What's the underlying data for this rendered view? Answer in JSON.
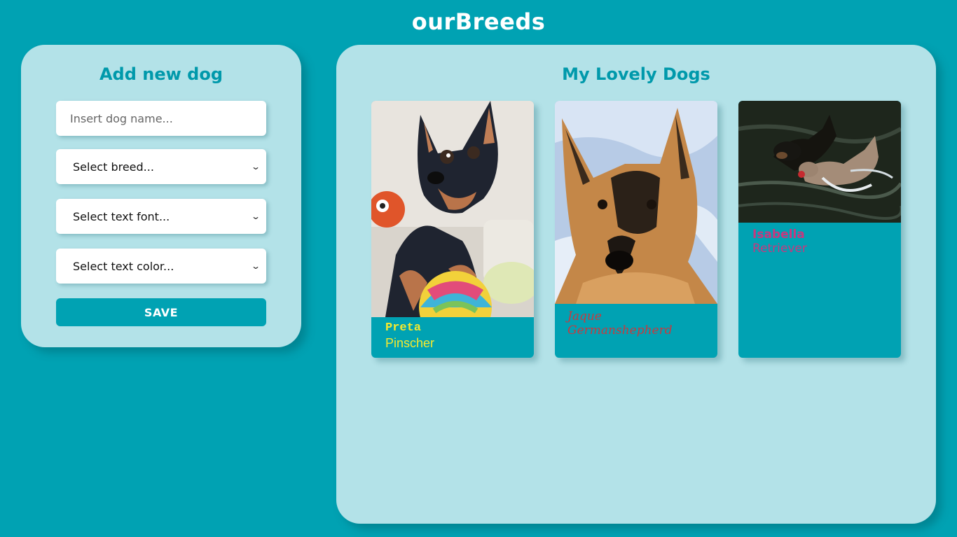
{
  "app": {
    "title": "ourBreeds"
  },
  "form": {
    "title": "Add new dog",
    "name_placeholder": "Insert dog name...",
    "breed_select": "Select breed...",
    "font_select": "Select text font...",
    "color_select": "Select text color...",
    "save_label": "SAVE"
  },
  "dogs": {
    "title": "My Lovely Dogs",
    "cards": [
      {
        "name": "Preta",
        "breed": "Pinscher",
        "text_color": "#f5e92e"
      },
      {
        "name": "Jaque",
        "breed": "Germanshepherd",
        "text_color": "#c8393d"
      },
      {
        "name": "Isabella",
        "breed": "Retriever",
        "text_color": "#c7387f"
      }
    ]
  },
  "colors": {
    "background": "#00a2b3",
    "panel": "#b3e2e8",
    "accent": "#0099ab"
  }
}
